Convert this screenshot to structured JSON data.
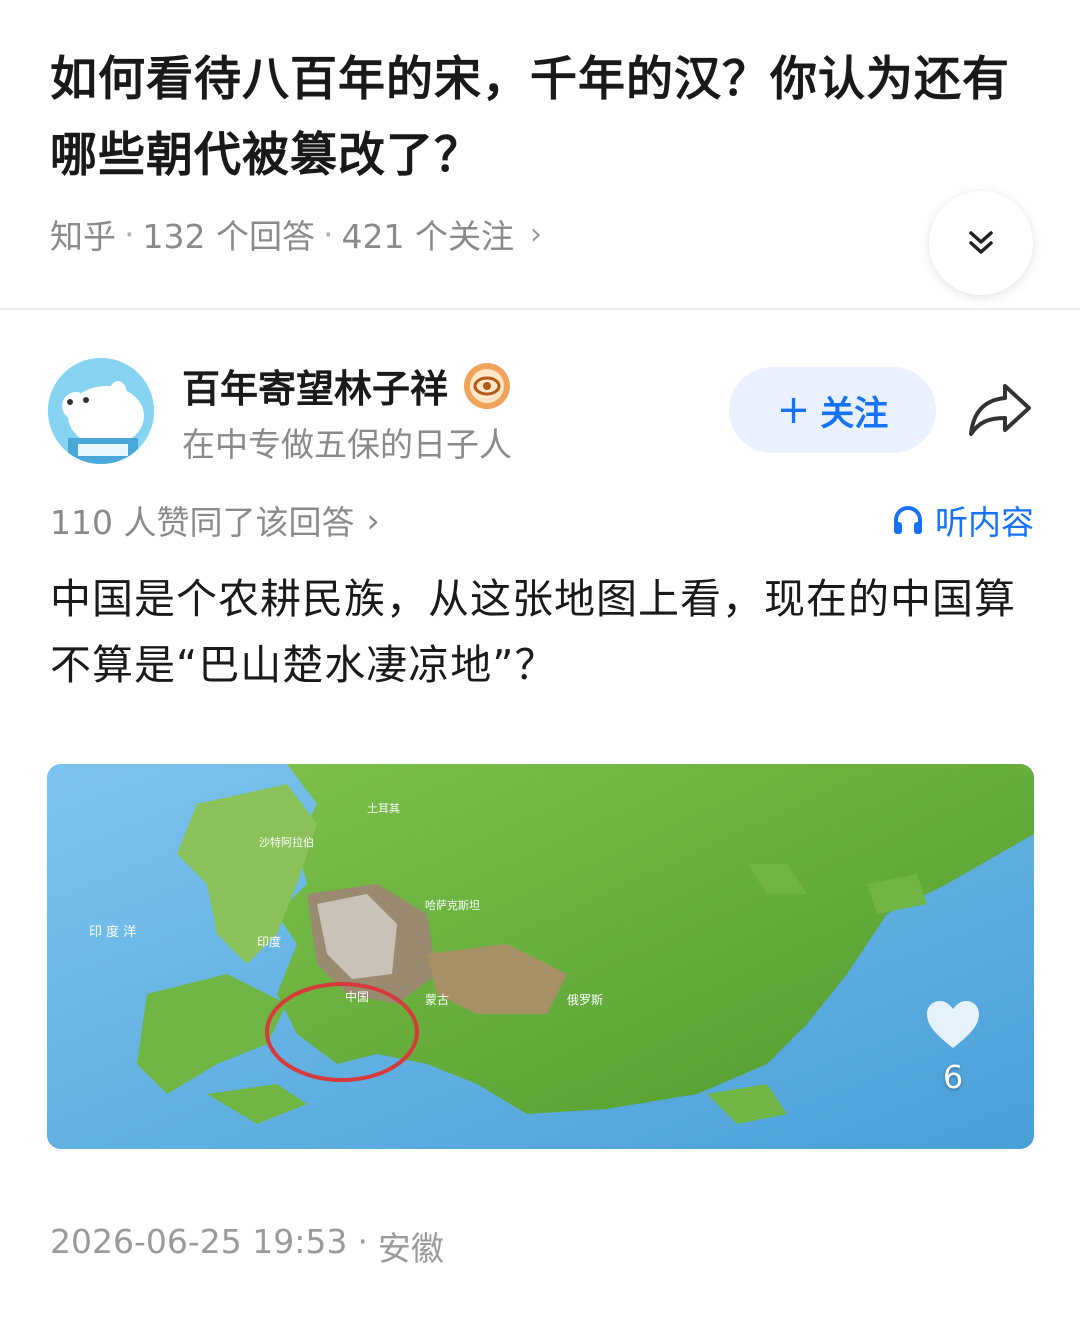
{
  "question": {
    "title": "如何看待八百年的宋，千年的汉？你认为还有哪些朝代被篡改了？",
    "source": "知乎",
    "answers": "132 个回答",
    "followers": "421 个关注",
    "separator": "·",
    "chevron": "›"
  },
  "author": {
    "name": "百年寄望林子祥",
    "bio": "在中专做五保的日子人",
    "follow_label": "关注",
    "follow_plus": "+"
  },
  "answer": {
    "votes": "110 人赞同了该回答",
    "listen_label": "听内容",
    "text": "中国是个农耕民族，从这张地图上看，现在的中国算不算是“巴山楚水凄凉地”？",
    "like_count": "6",
    "timestamp": "2026-06-25 19:53",
    "location": "安徽"
  },
  "map_labels": {
    "ocean": "印 度 洋",
    "china": "中国",
    "mongolia": "蒙古",
    "russia": "俄罗斯",
    "india": "印度",
    "kazakhstan": "哈萨克斯坦",
    "turkey": "土耳其",
    "saudi": "沙特阿拉伯"
  },
  "colors": {
    "accent": "#1772f6",
    "follow_bg": "#e9f1ff",
    "meta_gray": "#8a8a8a",
    "circle": "#d63a3a"
  }
}
